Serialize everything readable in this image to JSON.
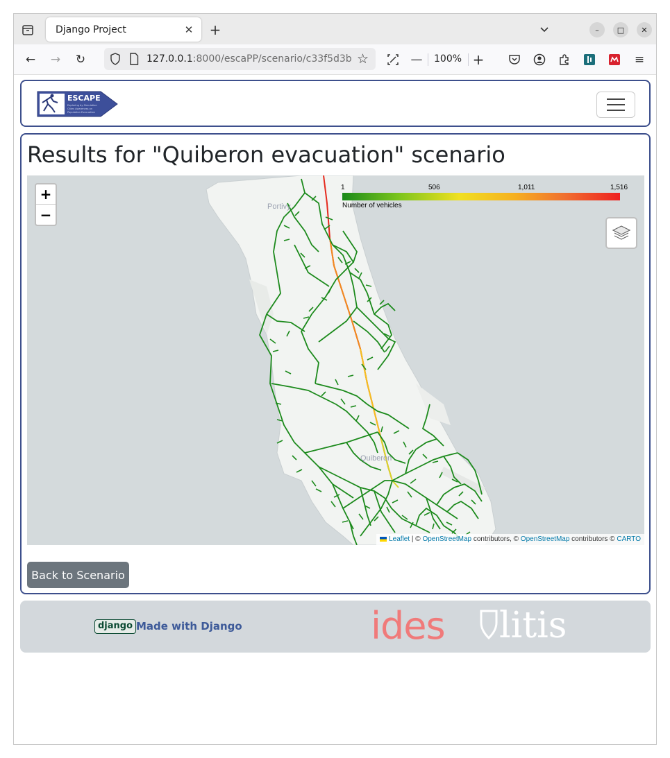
{
  "browser": {
    "tab_title": "Django Project",
    "url_host": "127.0.0.1",
    "url_rest": ":8000/escaPP/scenario/c33f5d3b-",
    "zoom": "100%"
  },
  "site": {
    "logo_text": "ESCAPE",
    "logo_subtitle": "Exploring by Simulation Cities Awareness on Population Evacuation"
  },
  "main": {
    "title": "Results for \"Quiberon evacuation\" scenario",
    "back_button": "Back to Scenario"
  },
  "map": {
    "zoom_in": "+",
    "zoom_out": "−",
    "legend": {
      "ticks": [
        "1",
        "506",
        "1,011",
        "1,516"
      ],
      "caption": "Number of vehicles",
      "colors": [
        "#1a8a1a",
        "#7ac41d",
        "#f0e020",
        "#f6b020",
        "#f07030",
        "#ee2020"
      ]
    },
    "places": [
      "Portivy",
      "Quiberon"
    ],
    "attribution": {
      "leaflet": "Leaflet",
      "sep1": " | © ",
      "osm1": "OpenStreetMap",
      "mid": " contributors, © ",
      "osm2": "OpenStreetMap",
      "mid2": " contributors © ",
      "carto": "CARTO"
    }
  },
  "footer": {
    "django_badge": "django",
    "made_with": "Made with Django",
    "ides": "ides",
    "litis": "litis"
  },
  "colors": {
    "brand": "#3d4f8c",
    "button_secondary": "#6c757d",
    "footer_bg": "#d3d8dc"
  }
}
